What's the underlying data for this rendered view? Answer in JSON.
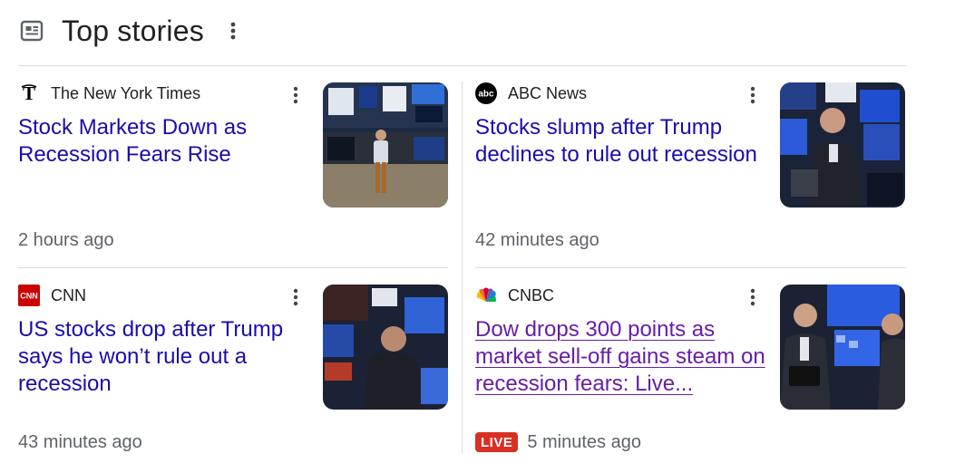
{
  "header": {
    "title": "Top stories",
    "icon": "newspaper-icon",
    "more_icon": "more-vertical-icon"
  },
  "stories": [
    {
      "source": "The New York Times",
      "source_icon": "nyt-logo",
      "headline": "Stock Markets Down as Recession Fears Rise",
      "time": "2 hours ago",
      "thumbnail": "trader-on-floor-thumbnail"
    },
    {
      "source": "ABC News",
      "source_icon": "abc-logo",
      "headline": "Stocks slump after Trump declines to rule out recession",
      "time": "42 minutes ago",
      "thumbnail": "trader-at-screens-thumbnail"
    },
    {
      "source": "CNN",
      "source_icon": "cnn-logo",
      "headline": "US stocks drop after Trump says he won’t rule out a recession",
      "time": "43 minutes ago",
      "thumbnail": "trader-blurred-thumbnail"
    },
    {
      "source": "CNBC",
      "source_icon": "cnbc-peacock-logo",
      "headline": "Dow drops 300 points as market sell-off gains steam on recession fears: Live...",
      "time": "5 minutes ago",
      "badge": "LIVE",
      "thumbnail": "trader-with-tablet-thumbnail"
    }
  ],
  "colors": {
    "link": "#1a0dab",
    "visited_link": "#681da8",
    "live_badge": "#d93025",
    "divider": "#dadce0",
    "meta_text": "#5f6368"
  }
}
